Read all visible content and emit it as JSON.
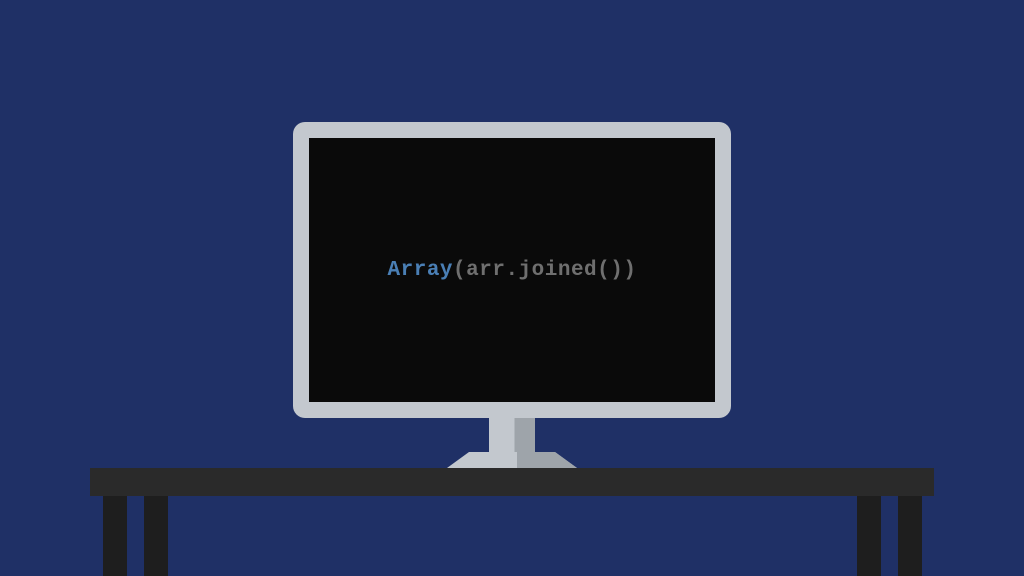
{
  "code": {
    "keyword": "Array",
    "rest": "(arr.joined())"
  },
  "colors": {
    "background": "#1f3066",
    "screen": "#0a0a0a",
    "bezel": "#c3c8ce",
    "keyword": "#4a7fb5",
    "plain": "#6f6f6f",
    "desk_top": "#2a2a2a",
    "desk_leg": "#1e1e1e"
  }
}
